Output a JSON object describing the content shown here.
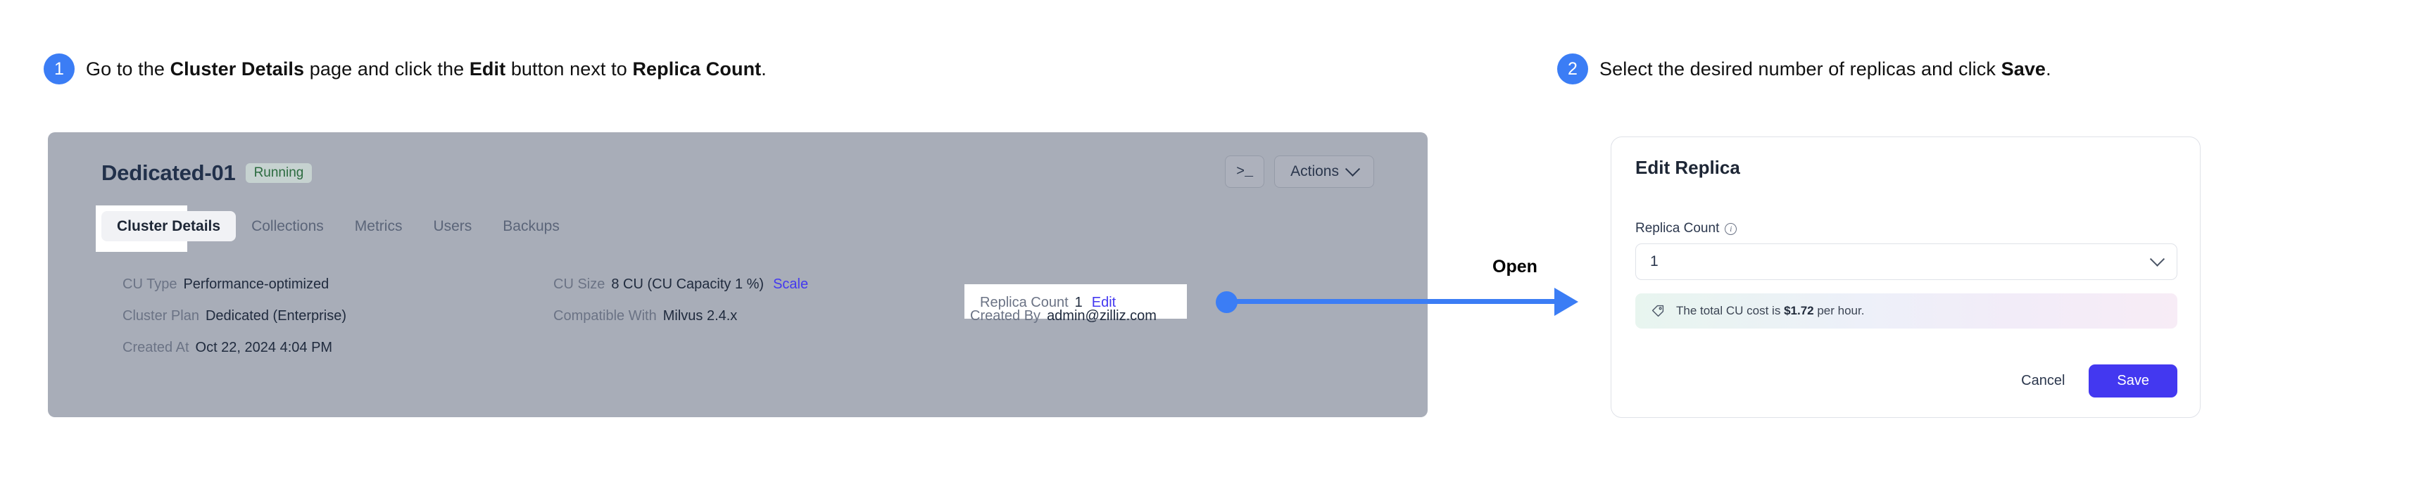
{
  "steps": [
    {
      "number": "1",
      "parts": [
        {
          "t": "Go to the ",
          "b": false
        },
        {
          "t": "Cluster Details",
          "b": true
        },
        {
          "t": " page and click the ",
          "b": false
        },
        {
          "t": "Edit",
          "b": true
        },
        {
          "t": " button next to ",
          "b": false
        },
        {
          "t": "Replica Count",
          "b": true
        },
        {
          "t": ".",
          "b": false
        }
      ]
    },
    {
      "number": "2",
      "parts": [
        {
          "t": "Select the desired number of replicas and click ",
          "b": false
        },
        {
          "t": "Save",
          "b": true
        },
        {
          "t": ".",
          "b": false
        }
      ]
    }
  ],
  "cluster_panel": {
    "name": "Dedicated-01",
    "status": "Running",
    "terminal_button": ">_",
    "actions_button": "Actions",
    "tabs": [
      {
        "label": "Cluster Details",
        "active": true
      },
      {
        "label": "Collections",
        "active": false
      },
      {
        "label": "Metrics",
        "active": false
      },
      {
        "label": "Users",
        "active": false
      },
      {
        "label": "Backups",
        "active": false
      }
    ],
    "details": {
      "cu_type_label": "CU Type",
      "cu_type_value": "Performance-optimized",
      "cluster_plan_label": "Cluster Plan",
      "cluster_plan_value": "Dedicated (Enterprise)",
      "created_at_label": "Created At",
      "created_at_value": "Oct 22, 2024 4:04 PM",
      "cu_size_label": "CU Size",
      "cu_size_value": "8 CU (CU Capacity 1 %)",
      "cu_size_link": "Scale",
      "compatible_label": "Compatible With",
      "compatible_value": "Milvus 2.4.x",
      "replica_count_label": "Replica Count",
      "replica_count_value": "1",
      "replica_count_link": "Edit",
      "created_by_label": "Created By",
      "created_by_value": "admin@zilliz.com"
    }
  },
  "annotation": {
    "open_label": "Open"
  },
  "edit_modal": {
    "title": "Edit Replica",
    "field_label": "Replica Count",
    "selected_value": "1",
    "cost_prefix": "The total CU cost is ",
    "cost_amount": "$1.72",
    "cost_suffix": " per hour.",
    "cancel_label": "Cancel",
    "save_label": "Save"
  },
  "colors": {
    "accent_blue": "#3b7df5",
    "brand_indigo": "#4338f0",
    "panel_overlay": "#a8adb8",
    "status_green": "#2b6b3f"
  }
}
